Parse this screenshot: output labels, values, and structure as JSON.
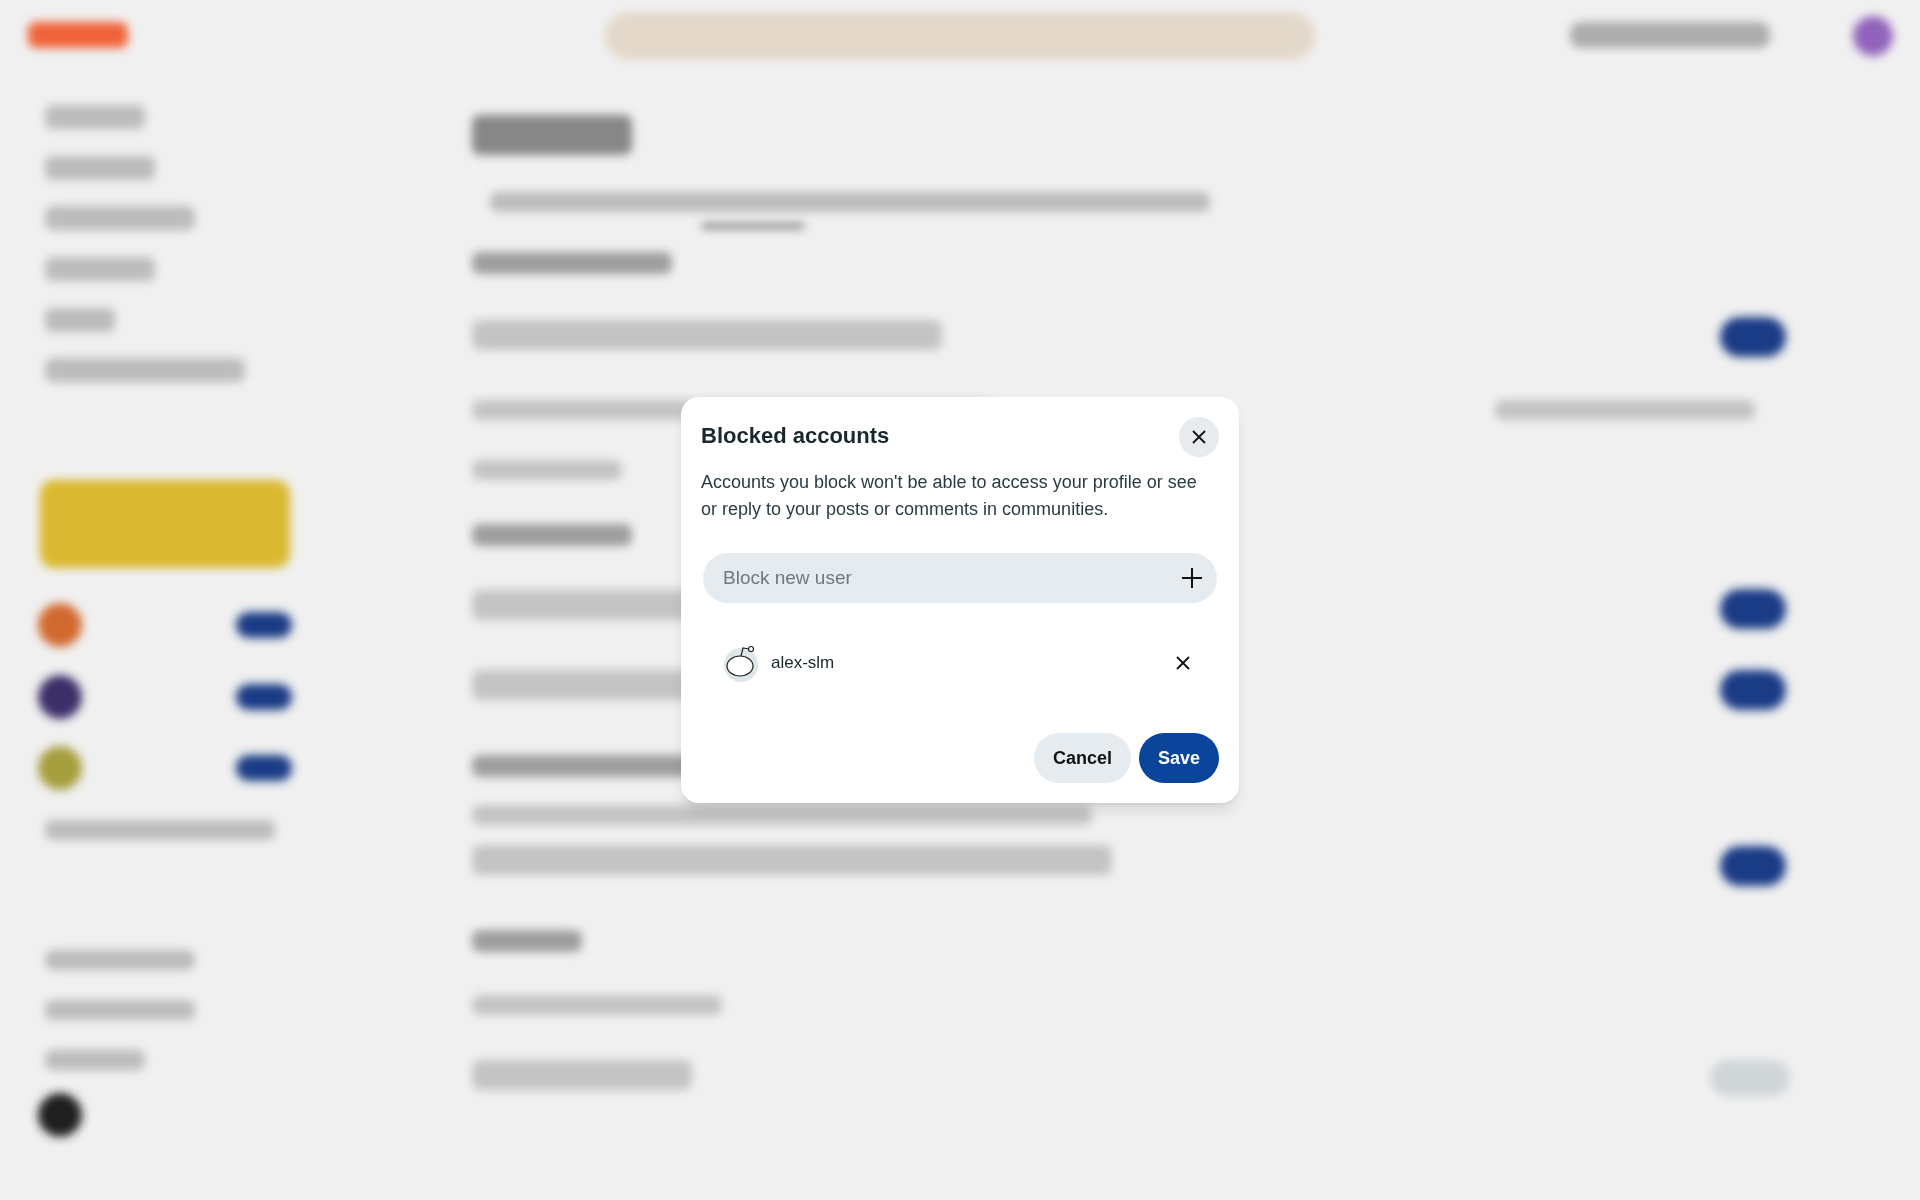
{
  "dialog": {
    "title": "Blocked accounts",
    "description": "Accounts you block won't be able to access your profile or see or reply to your posts or comments in communities.",
    "search": {
      "placeholder": "Block new user"
    },
    "blocked_users": [
      {
        "username": "alex-slm"
      }
    ],
    "buttons": [
      {
        "label": "Cancel",
        "kind": "secondary"
      },
      {
        "label": "Save",
        "kind": "primary"
      }
    ]
  }
}
